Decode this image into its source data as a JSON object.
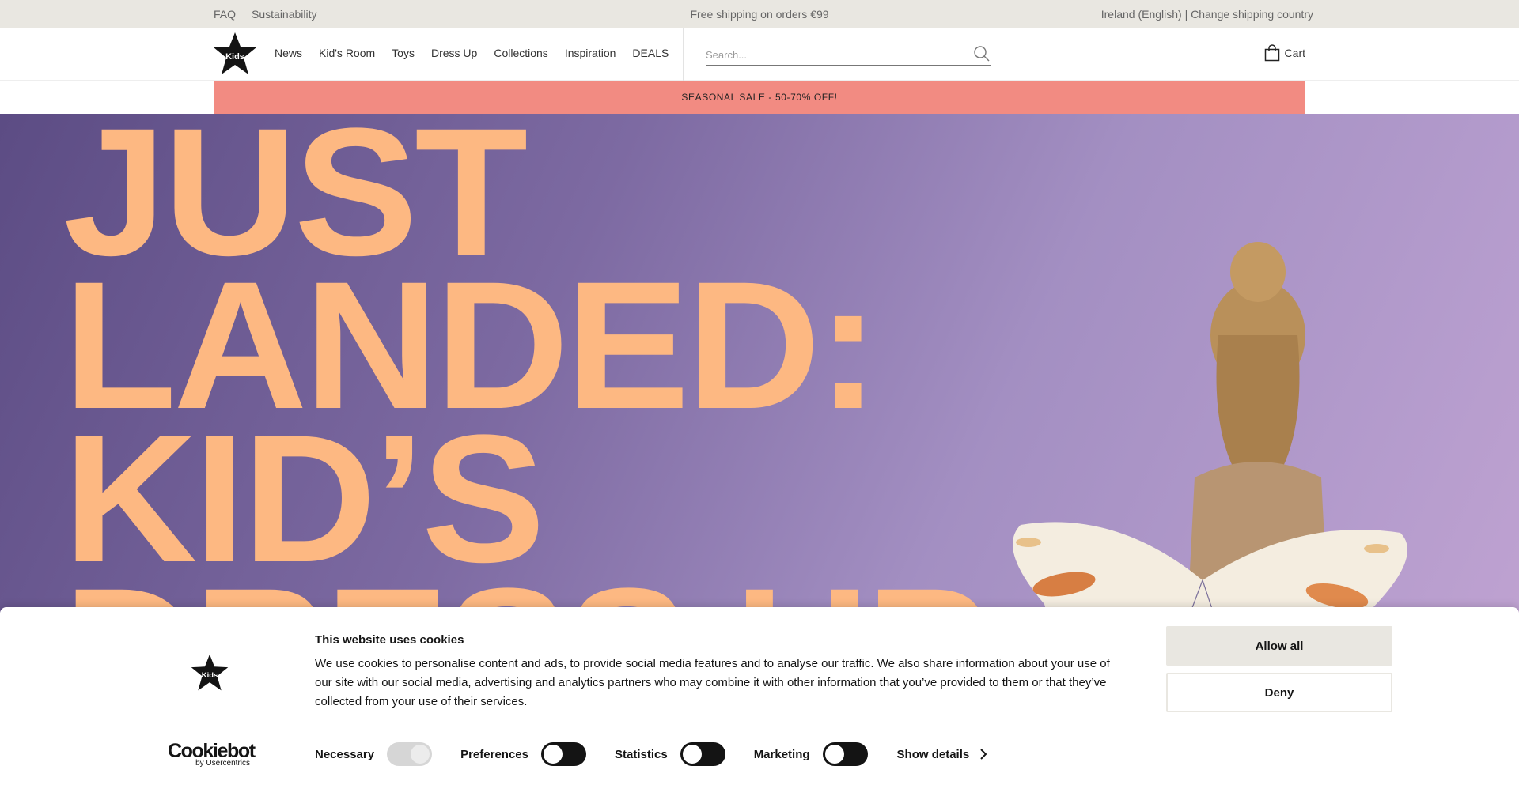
{
  "topbar": {
    "faq": "FAQ",
    "sustainability": "Sustainability",
    "shipping_promo": "Free shipping on orders €99",
    "country": "Ireland (English) | Change shipping country"
  },
  "header": {
    "logo_text": "Kids",
    "nav": [
      "News",
      "Kid's Room",
      "Toys",
      "Dress Up",
      "Collections",
      "Inspiration",
      "DEALS"
    ],
    "search_placeholder": "Search...",
    "search_icon": "search-icon",
    "cart_label": "Cart",
    "cart_icon": "shopping-bag-icon"
  },
  "sale_banner": "SEASONAL SALE - 50-70% OFF!",
  "hero": {
    "headline": "JUST\nLANDED:\nKID’S\nDRESS UP"
  },
  "cookie": {
    "logo_text": "Kids",
    "title": "This website uses cookies",
    "body": "We use cookies to personalise content and ads, to provide social media features and to analyse our traffic. We also share information about your use of our site with our social media, advertising and analytics partners who may combine it with other information that you’ve provided to them or that they’ve collected from your use of their services.",
    "allow_all": "Allow all",
    "deny": "Deny",
    "brand_name": "Cookiebot",
    "brand_sub": "by Usercentrics",
    "toggles": [
      {
        "label": "Necessary",
        "state": "on-disabled"
      },
      {
        "label": "Preferences",
        "state": "off"
      },
      {
        "label": "Statistics",
        "state": "off"
      },
      {
        "label": "Marketing",
        "state": "off"
      }
    ],
    "show_details": "Show details"
  },
  "colors": {
    "topbar_bg": "#e9e7e1",
    "sale_bg": "#f28b82",
    "hero_text": "#fdb882",
    "hero_bg": "#7d6aa2",
    "dark": "#141414"
  }
}
